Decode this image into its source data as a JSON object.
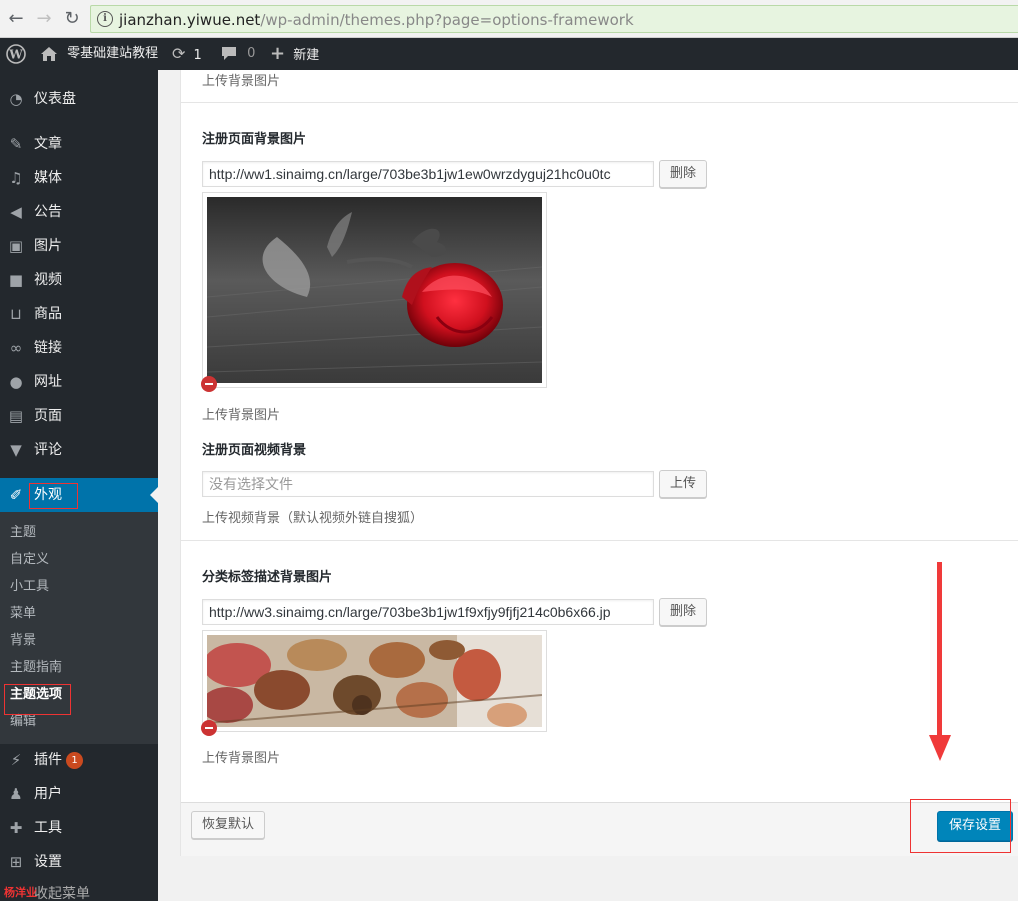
{
  "browser": {
    "url_host": "jianzhan.yiwue.net",
    "url_path": "/wp-admin/themes.php?page=options-framework"
  },
  "admin_bar": {
    "site_name": "零基础建站教程",
    "updates_count": "1",
    "comments_count": "0",
    "new_label": "新建"
  },
  "sidebar": {
    "items": [
      {
        "label": "仪表盘",
        "icon": "dashboard-icon"
      },
      {
        "label": "文章",
        "icon": "pin-icon"
      },
      {
        "label": "媒体",
        "icon": "media-icon"
      },
      {
        "label": "公告",
        "icon": "megaphone-icon"
      },
      {
        "label": "图片",
        "icon": "image-icon"
      },
      {
        "label": "视频",
        "icon": "video-icon"
      },
      {
        "label": "商品",
        "icon": "cart-icon"
      },
      {
        "label": "链接",
        "icon": "link-icon"
      },
      {
        "label": "网址",
        "icon": "globe-icon"
      },
      {
        "label": "页面",
        "icon": "page-icon"
      },
      {
        "label": "评论",
        "icon": "comment-icon"
      },
      {
        "label": "外观",
        "icon": "brush-icon"
      },
      {
        "label": "插件",
        "icon": "plugin-icon",
        "badge": "1"
      },
      {
        "label": "用户",
        "icon": "user-icon"
      },
      {
        "label": "工具",
        "icon": "wrench-icon"
      },
      {
        "label": "设置",
        "icon": "settings-icon"
      }
    ],
    "submenu": [
      "主题",
      "自定义",
      "小工具",
      "菜单",
      "背景",
      "主题指南",
      "主题选项",
      "编辑"
    ],
    "collapse_label": "收起菜单"
  },
  "content": {
    "top_desc": "上传背景图片",
    "register_bg": {
      "label": "注册页面背景图片",
      "value": "http://ww1.sinaimg.cn/large/703be3b1jw1ew0wrzdyguj21hc0u0tc",
      "remove_label": "删除",
      "desc": "上传背景图片"
    },
    "register_video": {
      "label": "注册页面视频背景",
      "placeholder": "没有选择文件",
      "upload_label": "上传",
      "desc": "上传视频背景（默认视频外链自搜狐）"
    },
    "category_bg": {
      "label": "分类标签描述背景图片",
      "value": "http://ww3.sinaimg.cn/large/703be3b1jw1f9xfjy9fjfj214c0b6x66.jp",
      "remove_label": "删除",
      "desc": "上传背景图片"
    },
    "reset_label": "恢复默认",
    "save_label": "保存设置"
  },
  "watermark": "杨洋业"
}
